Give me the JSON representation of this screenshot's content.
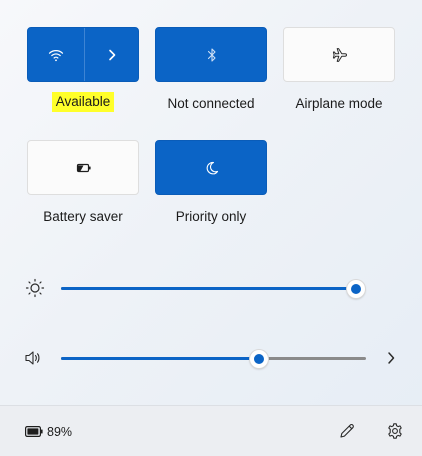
{
  "tiles": {
    "wifi": {
      "label": "Available",
      "state": "on",
      "icon": "wifi-icon",
      "expand_icon": "chevron-right-icon"
    },
    "bluetooth": {
      "label": "Not connected",
      "state": "on",
      "icon": "bluetooth-icon"
    },
    "airplane": {
      "label": "Airplane mode",
      "state": "off",
      "icon": "airplane-icon"
    },
    "battery_saver": {
      "label": "Battery saver",
      "state": "off",
      "icon": "battery-saver-icon"
    },
    "focus": {
      "label": "Priority only",
      "state": "on",
      "icon": "moon-icon"
    }
  },
  "sliders": {
    "brightness": {
      "icon": "sun-icon",
      "value_fraction": 1.0
    },
    "volume": {
      "icon": "speaker-icon",
      "value_fraction": 0.65,
      "expand_icon": "chevron-right-icon"
    }
  },
  "footer": {
    "battery_percent": "89%",
    "battery_icon": "battery-icon",
    "edit_icon": "pencil-icon",
    "settings_icon": "gear-icon"
  },
  "colors": {
    "accent": "#0b64c6",
    "highlight": "#ffff2a",
    "tile_off": "#fbfbfb",
    "track": "#8a8a8a"
  }
}
